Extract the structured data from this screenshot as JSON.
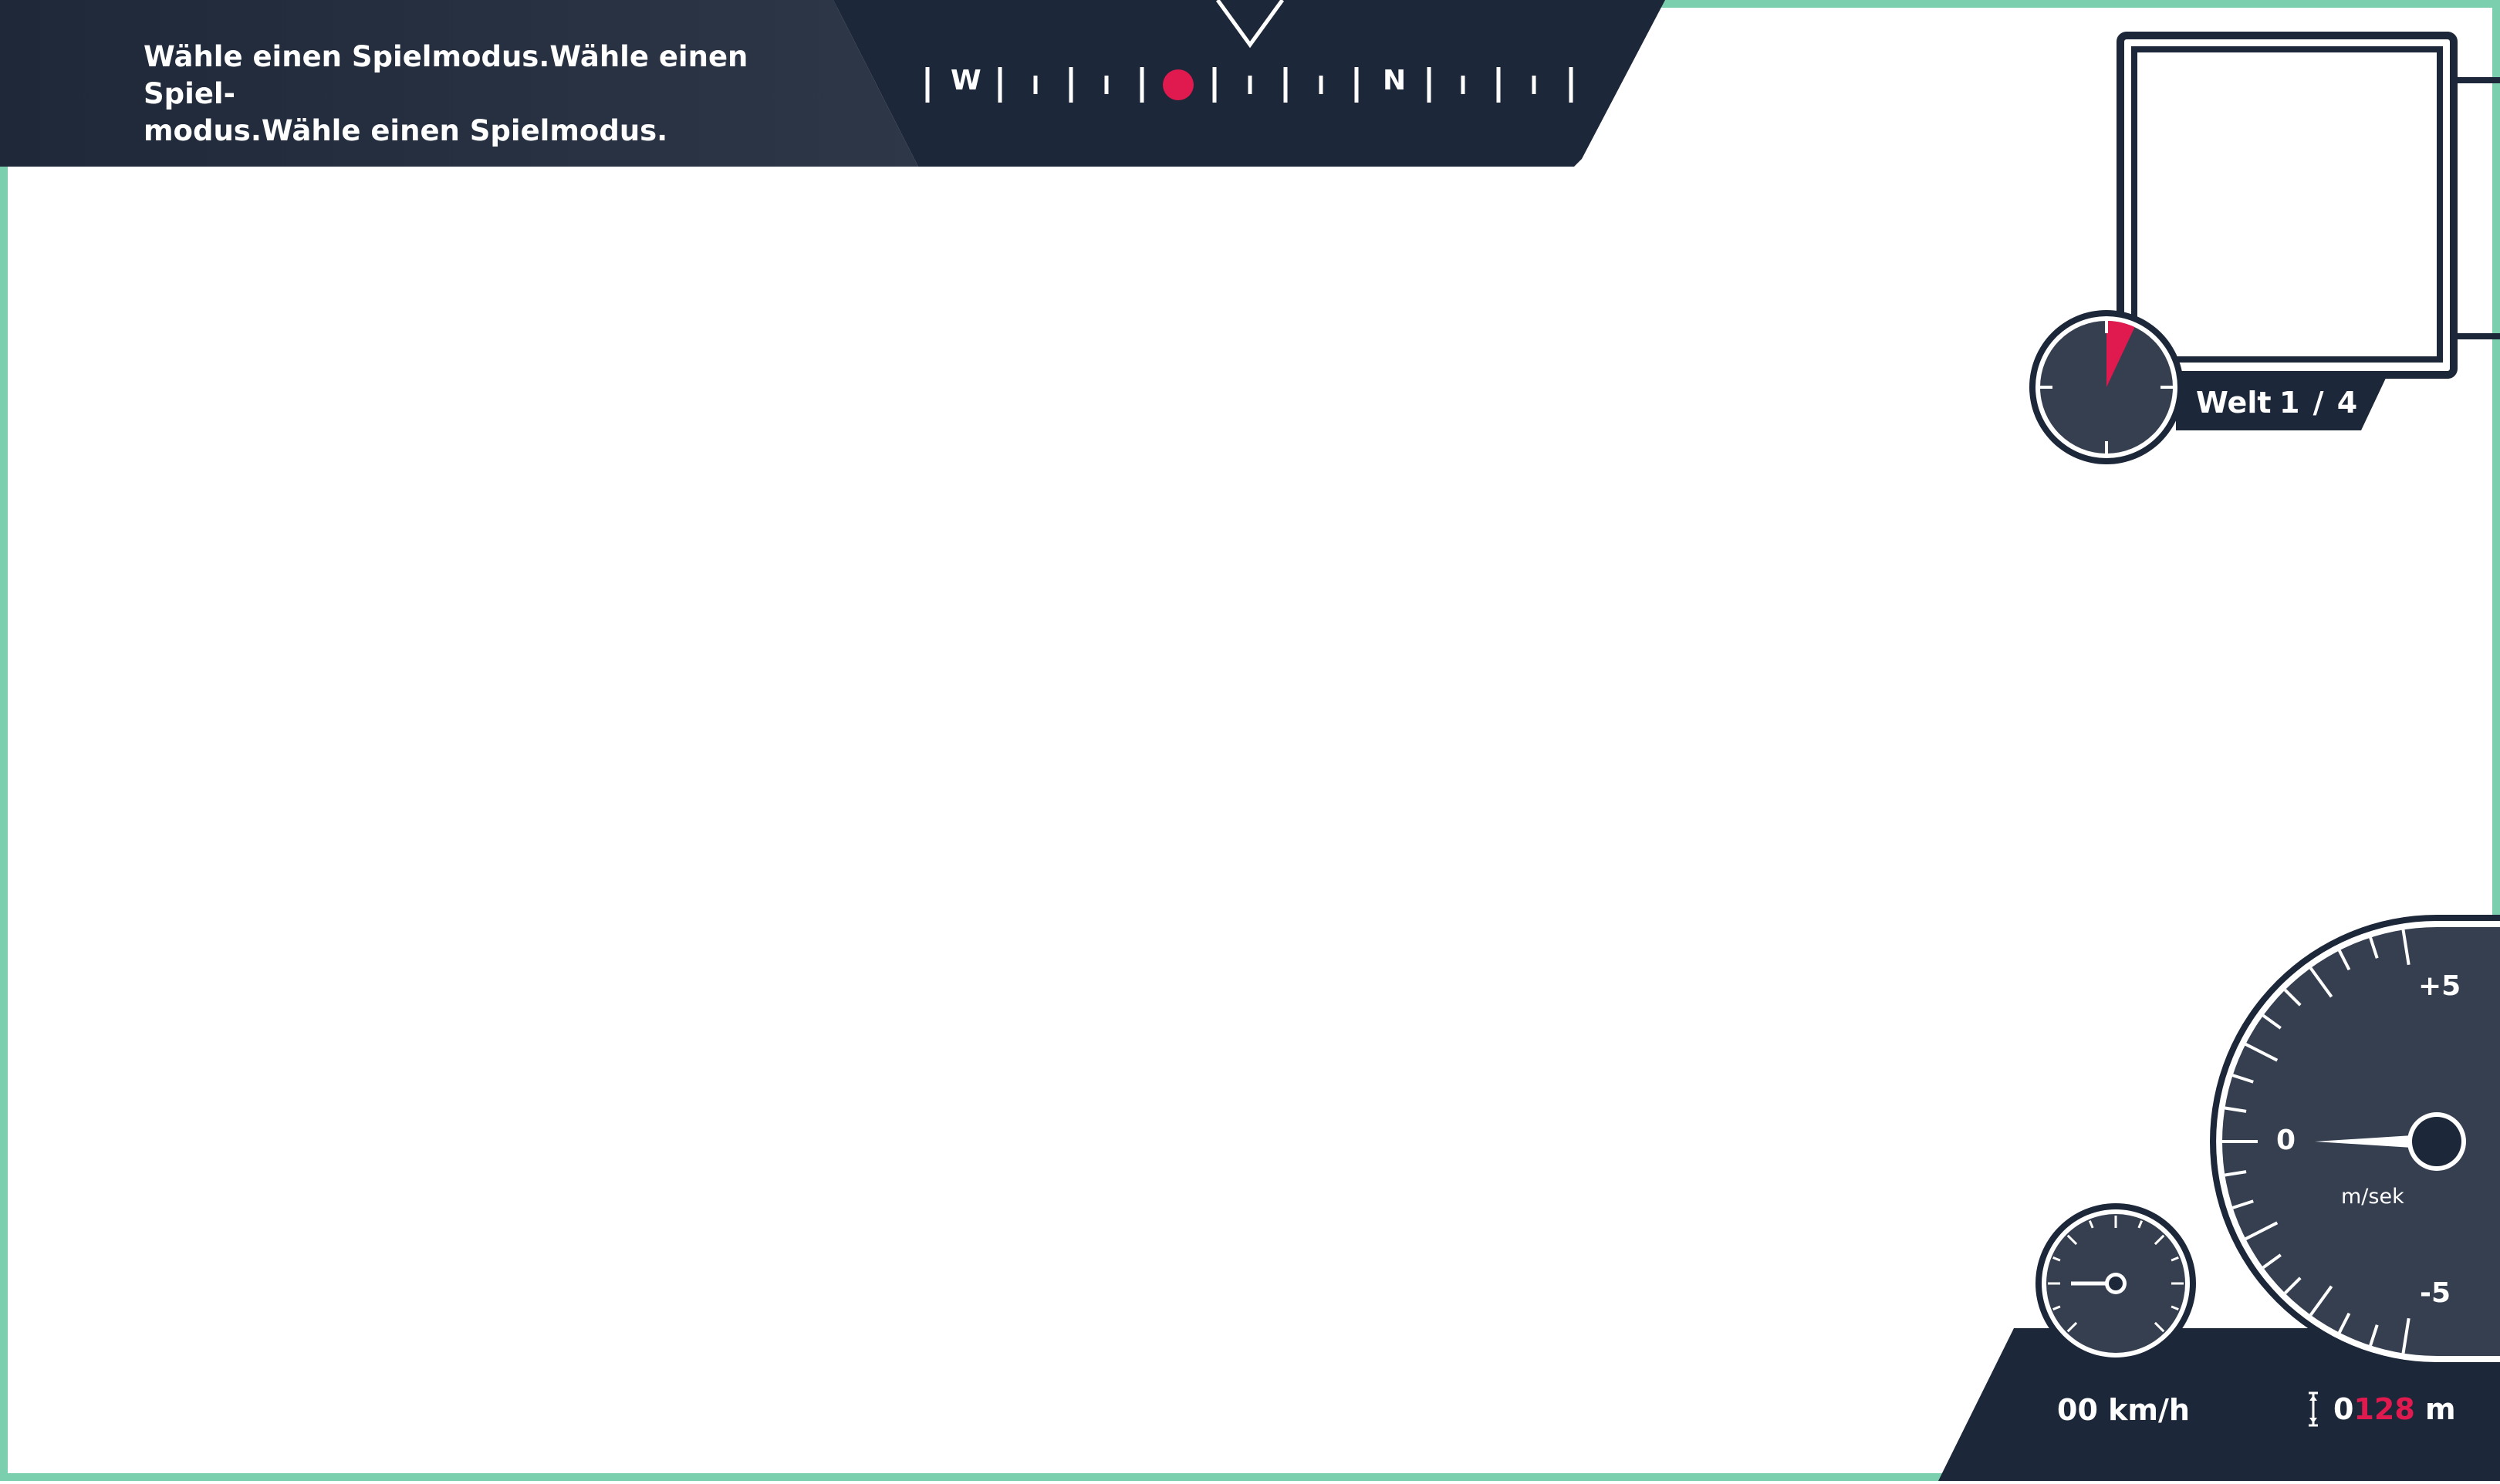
{
  "hud": {
    "mode_prompt": "Wähle einen Spielmodus.Wähle einen Spiel-modus.Wähle einen Spielmodus.",
    "compass": {
      "west": "W",
      "north": "N"
    },
    "world": {
      "label": "Welt",
      "count": "1 / 4"
    },
    "vario": {
      "plus": "+5",
      "zero": "0",
      "minus": "-5",
      "unit": "m/sek"
    },
    "speed": "00 km/h",
    "altitude": {
      "prefix": "0",
      "value": "128",
      "unit": "m"
    },
    "timer_fraction": 0.07,
    "colors": {
      "panel": "#1c2739",
      "gauge": "#353f50",
      "accent": "#e0194f",
      "border": "#7ccfae"
    }
  }
}
